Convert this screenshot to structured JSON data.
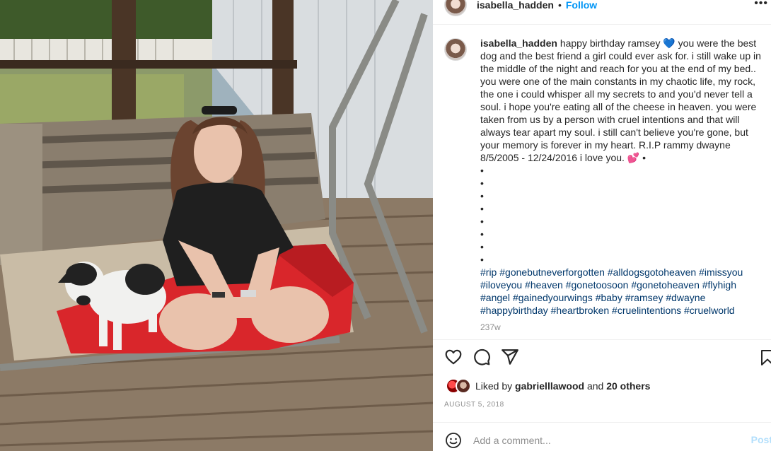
{
  "post": {
    "username": "isabella_hadden",
    "follow_label": "Follow",
    "more_label": "•••",
    "header_separator": "•"
  },
  "caption": {
    "username": "isabella_hadden",
    "text": "happy birthday ramsey 💙 you were the best dog and the best friend a girl could ever ask for. i still wake up in the middle of the night and reach for you at the end of my bed.. you were one of the main constants in my chaotic life, my rock, the one i could whisper all my secrets to and you'd never tell a soul. i hope you're eating all of the cheese in heaven. you were taken from us by a person with cruel intentions and that will always tear apart my soul. i still can't believe you're gone, but your memory is forever in my heart. R.I.P rammy dwayne 8/5/2005 - 12/24/2016 i love you. 💕 •",
    "bullets": [
      "•",
      "•",
      "•",
      "•",
      "•",
      "•",
      "•",
      "•"
    ],
    "hashtags": [
      "#rip",
      "#gonebutneverforgotten",
      "#alldogsgotoheaven",
      "#imissyou",
      "#iloveyou",
      "#heaven",
      "#gonetoosoon",
      "#gonetoheaven",
      "#flyhigh",
      "#angel",
      "#gainedyourwings",
      "#baby",
      "#ramsey",
      "#dwayne",
      "#happybirthday",
      "#heartbroken",
      "#cruelintentions",
      "#cruelworld"
    ],
    "time_ago": "237w"
  },
  "actions": {
    "like_icon": "heart-icon",
    "comment_icon": "comment-icon",
    "share_icon": "share-icon",
    "save_icon": "bookmark-icon"
  },
  "likes": {
    "prefix": "Liked by ",
    "user": "gabrielllawood",
    "middle": " and ",
    "others": "20 others"
  },
  "date": "AUGUST 5, 2018",
  "comment": {
    "placeholder": "Add a comment...",
    "post_label": "Post",
    "emoji_icon": "smiley-icon"
  },
  "colors": {
    "link": "#0095f6",
    "hashtag": "#00376b",
    "muted": "#8e8e8e",
    "blanket": "#d9262b"
  }
}
